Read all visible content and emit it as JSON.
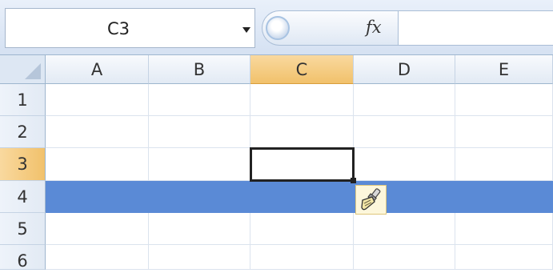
{
  "formula_bar": {
    "name_box": "C3",
    "fx_label": "fx",
    "formula_value": ""
  },
  "grid": {
    "columns": [
      "A",
      "B",
      "C",
      "D",
      "E"
    ],
    "rows": [
      "1",
      "2",
      "3",
      "4",
      "5",
      "6"
    ],
    "active_cell": "C3",
    "active_column": "C",
    "active_row": "3",
    "highlighted_row": "4"
  },
  "cursor": {
    "icon": "format-painter-brush-icon"
  },
  "colors": {
    "row_highlight": "#5a8ad6",
    "active_header": "#f4c87d"
  }
}
